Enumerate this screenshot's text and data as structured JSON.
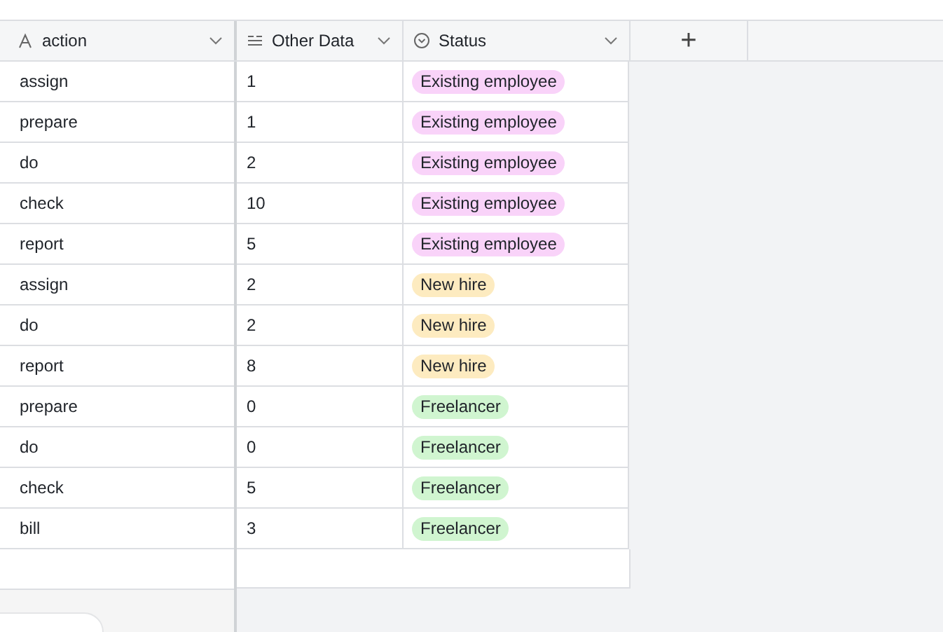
{
  "columns": [
    {
      "label": "action",
      "kind": "text"
    },
    {
      "label": "Other Data",
      "kind": "number"
    },
    {
      "label": "Status",
      "kind": "select"
    }
  ],
  "add_column": {
    "label": "+"
  },
  "rows": [
    {
      "action": "assign",
      "other_data": "1",
      "status": {
        "label": "Existing employee",
        "color": "#f9d3f9"
      }
    },
    {
      "action": "prepare",
      "other_data": "1",
      "status": {
        "label": "Existing employee",
        "color": "#f9d3f9"
      }
    },
    {
      "action": "do",
      "other_data": "2",
      "status": {
        "label": "Existing employee",
        "color": "#f9d3f9"
      }
    },
    {
      "action": "check",
      "other_data": "10",
      "status": {
        "label": "Existing employee",
        "color": "#f9d3f9"
      }
    },
    {
      "action": "report",
      "other_data": "5",
      "status": {
        "label": "Existing employee",
        "color": "#f9d3f9"
      }
    },
    {
      "action": "assign",
      "other_data": "2",
      "status": {
        "label": "New hire",
        "color": "#fdebc0"
      }
    },
    {
      "action": "do",
      "other_data": "2",
      "status": {
        "label": "New hire",
        "color": "#fdebc0"
      }
    },
    {
      "action": "report",
      "other_data": "8",
      "status": {
        "label": "New hire",
        "color": "#fdebc0"
      }
    },
    {
      "action": "prepare",
      "other_data": "0",
      "status": {
        "label": "Freelancer",
        "color": "#d0f5d0"
      }
    },
    {
      "action": "do",
      "other_data": "0",
      "status": {
        "label": "Freelancer",
        "color": "#d0f5d0"
      }
    },
    {
      "action": "check",
      "other_data": "5",
      "status": {
        "label": "Freelancer",
        "color": "#d0f5d0"
      }
    },
    {
      "action": "bill",
      "other_data": "3",
      "status": {
        "label": "Freelancer",
        "color": "#d0f5d0"
      }
    }
  ]
}
